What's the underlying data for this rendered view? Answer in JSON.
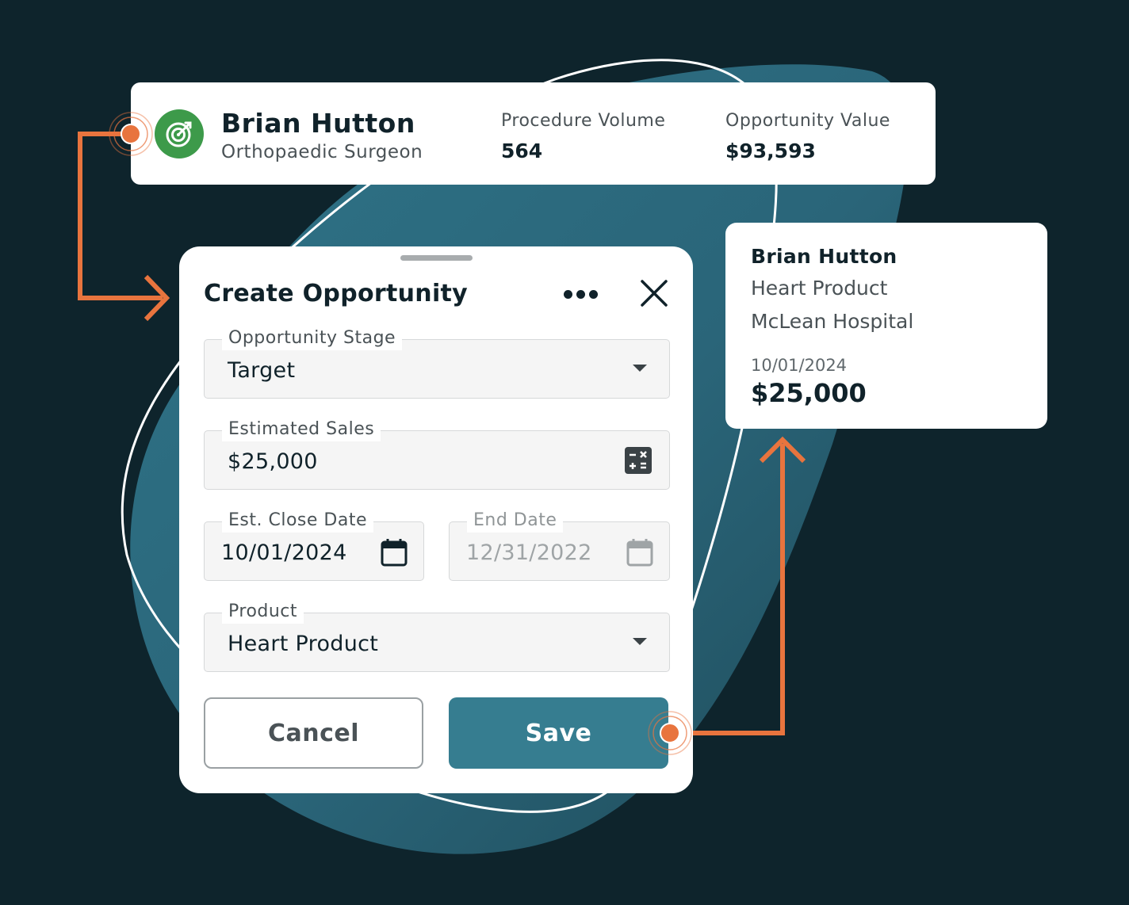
{
  "profile": {
    "name": "Brian Hutton",
    "role": "Orthopaedic Surgeon",
    "avatar_icon": "target-icon",
    "avatar_color": "#3d9a4a",
    "stats": [
      {
        "label": "Procedure Volume",
        "value": "564"
      },
      {
        "label": "Opportunity Value",
        "value": "$93,593"
      }
    ]
  },
  "dialog": {
    "title": "Create Opportunity",
    "more_icon": "more-horizontal-icon",
    "close_icon": "close-icon",
    "fields": {
      "stage": {
        "label": "Opportunity Stage",
        "value": "Target"
      },
      "sales": {
        "label": "Estimated Sales",
        "value": "$25,000"
      },
      "close_date": {
        "label": "Est. Close Date",
        "value": "10/01/2024"
      },
      "end_date": {
        "label": "End Date",
        "value": "12/31/2022"
      },
      "product": {
        "label": "Product",
        "value": "Heart Product"
      }
    },
    "cancel_label": "Cancel",
    "save_label": "Save"
  },
  "summary": {
    "name": "Brian Hutton",
    "product": "Heart Product",
    "hospital": "McLean Hospital",
    "date": "10/01/2024",
    "amount": "$25,000"
  },
  "colors": {
    "background": "#0e242c",
    "accent": "#367d90",
    "connector": "#e8743e",
    "avatar": "#3d9a4a"
  }
}
